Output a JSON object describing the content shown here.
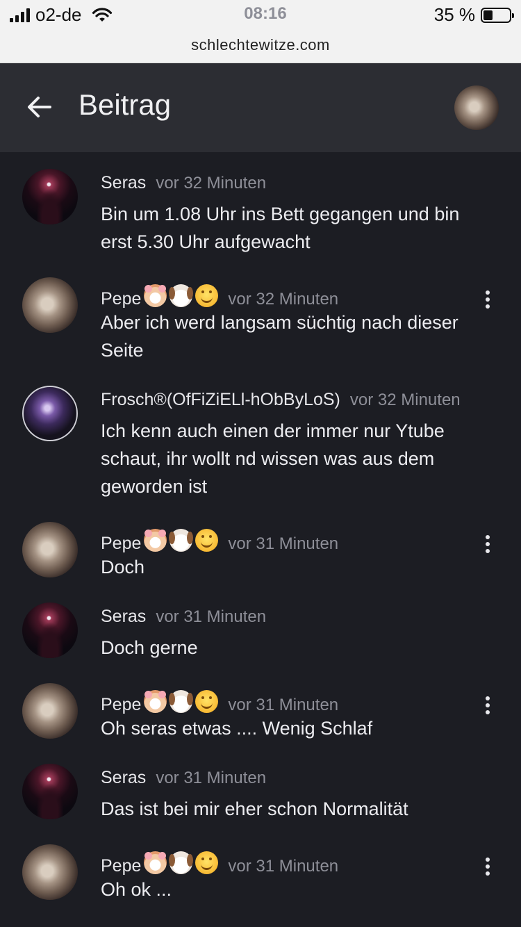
{
  "status_bar": {
    "carrier": "o2-de",
    "time": "08:16",
    "battery": "35 %"
  },
  "browser": {
    "url": "schlechtewitze.com"
  },
  "header": {
    "title": "Beitrag"
  },
  "comments": [
    {
      "author": "Seras",
      "time": "vor 32 Minuten",
      "text": "Bin um 1.08 Uhr ins Bett gegangen und bin erst 5.30 Uhr aufgewacht"
    },
    {
      "author": "Pepe",
      "time": "vor 32 Minuten",
      "text": "Aber ich werd langsam süchtig nach dieser Seite",
      "emojis": [
        "hamster-face",
        "dog-face",
        "smiling-face"
      ]
    },
    {
      "author": "Frosch®(OfFiZiELl-hObByLoS)",
      "time": "vor 32 Minuten",
      "text": "Ich kenn auch einen der immer nur Ytube schaut, ihr wollt nd wissen was aus dem geworden ist"
    },
    {
      "author": "Pepe",
      "time": "vor 31 Minuten",
      "text": "Doch",
      "emojis": [
        "hamster-face",
        "dog-face",
        "smiling-face"
      ]
    },
    {
      "author": "Seras",
      "time": "vor 31 Minuten",
      "text": "Doch gerne"
    },
    {
      "author": "Pepe",
      "time": "vor 31 Minuten",
      "text": "Oh seras etwas .... Wenig Schlaf",
      "emojis": [
        "hamster-face",
        "dog-face",
        "smiling-face"
      ]
    },
    {
      "author": "Seras",
      "time": "vor 31 Minuten",
      "text": "Das ist bei mir eher schon Normalität"
    },
    {
      "author": "Pepe",
      "time": "vor 31 Minuten",
      "text": "Oh ok ...",
      "emojis": [
        "hamster-face",
        "dog-face",
        "smiling-face"
      ]
    }
  ]
}
